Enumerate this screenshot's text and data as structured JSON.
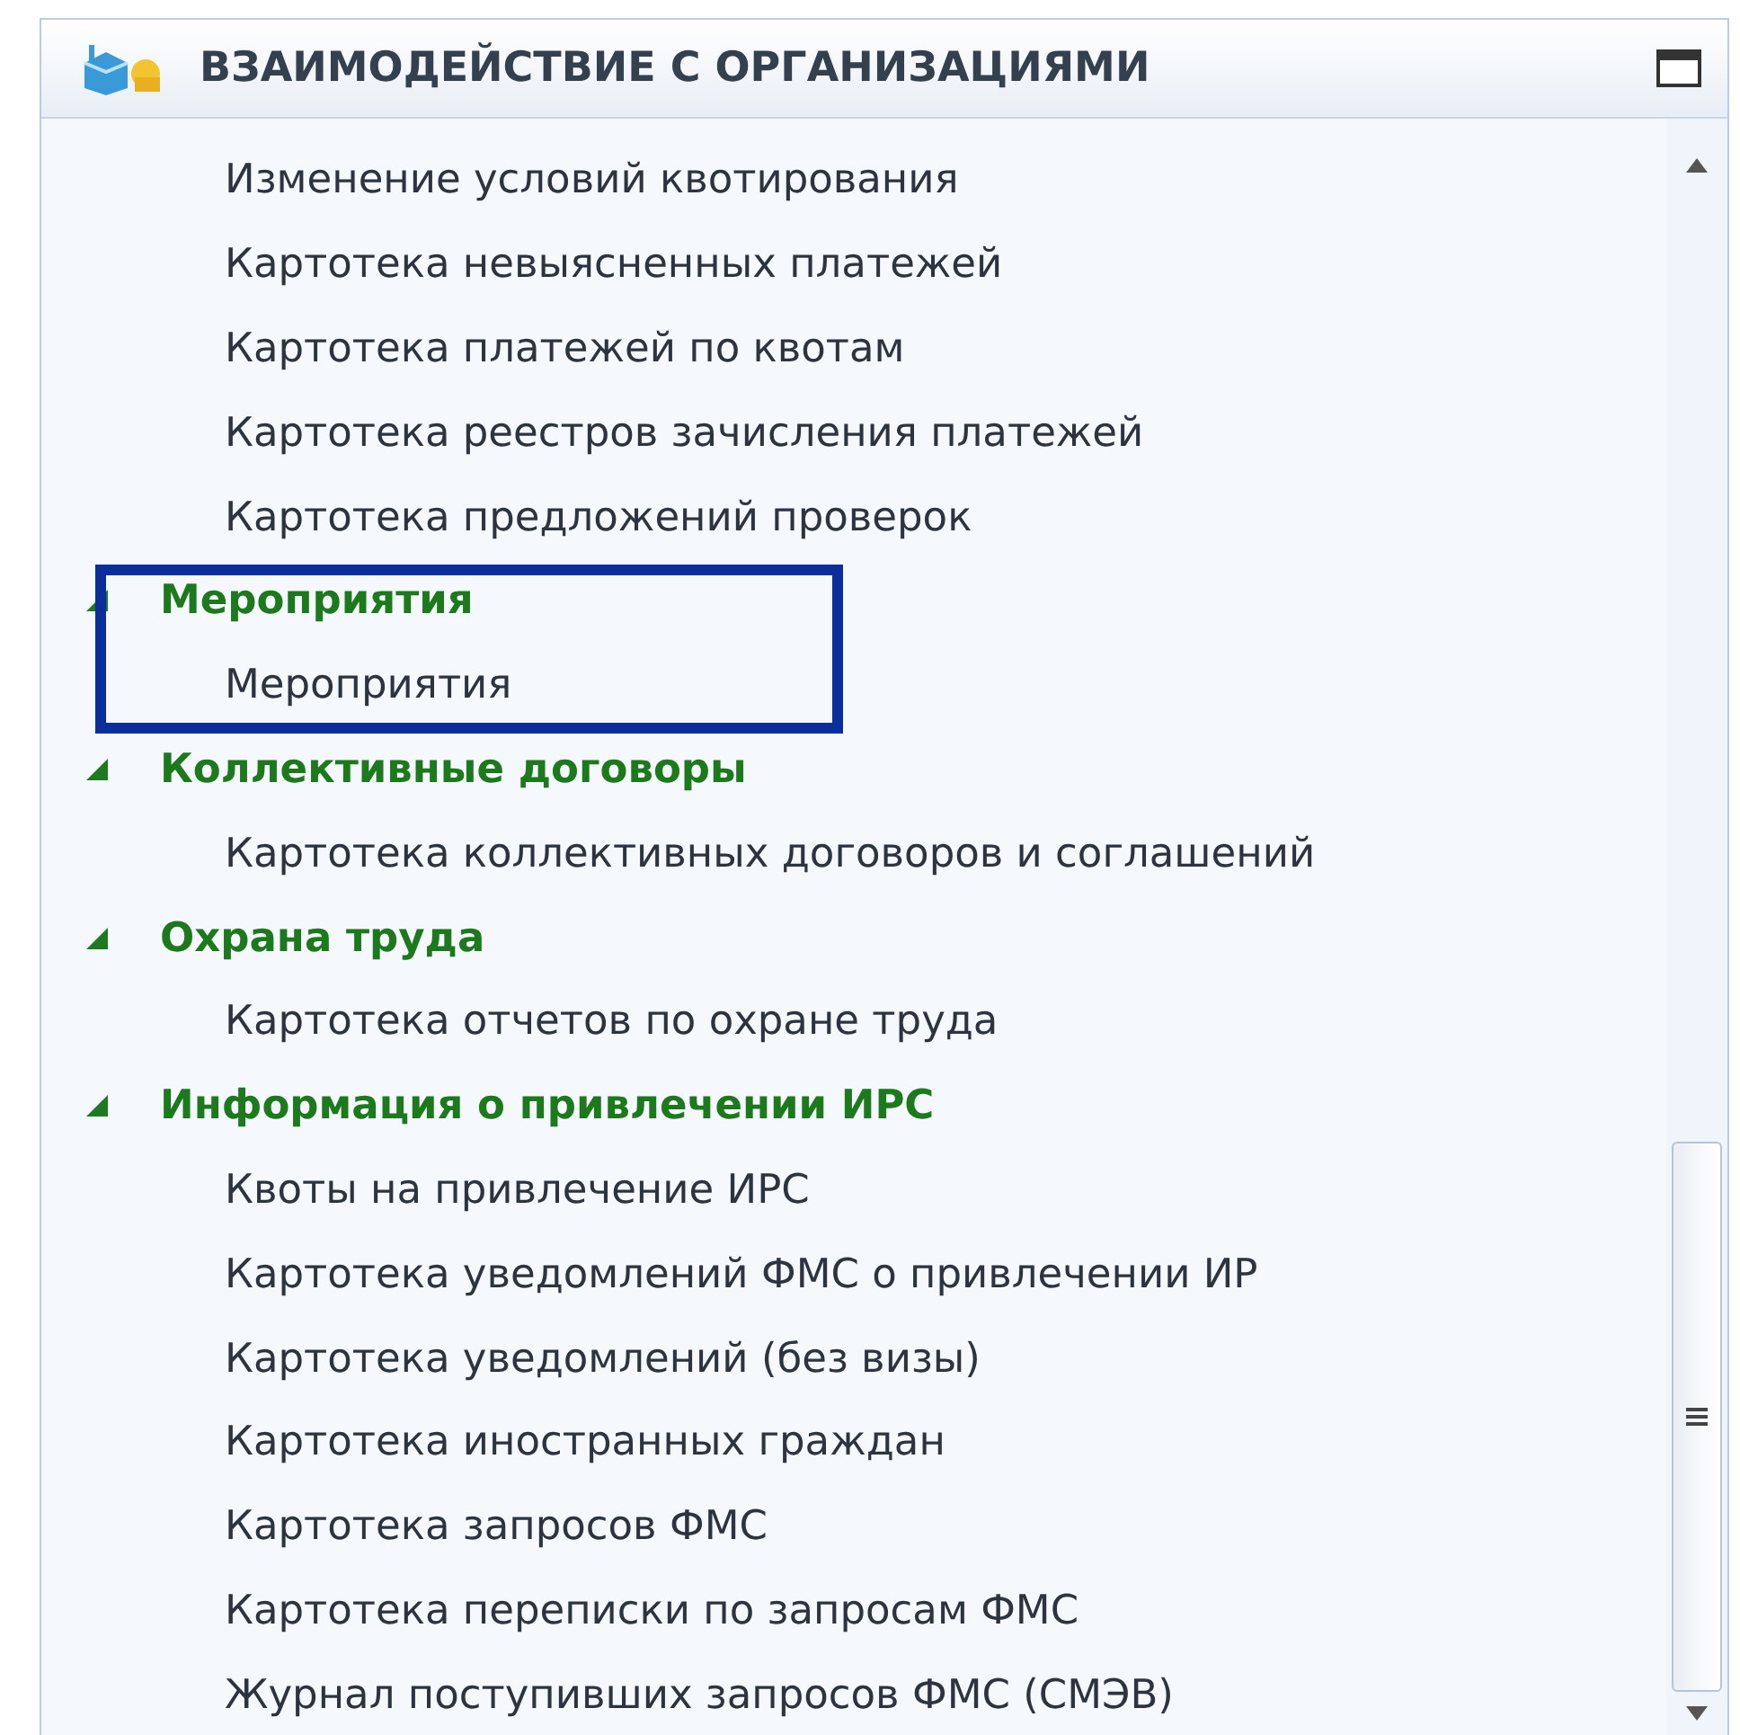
{
  "panel": {
    "title": "ВЗАИМОДЕЙСТВИЕ С ОРГАНИЗАЦИЯМИ"
  },
  "items": [
    "Изменение условий квотирования",
    "Картотека невыясненных платежей",
    "Картотека платежей по квотам",
    "Картотека реестров зачисления платежей",
    "Картотека предложений проверок"
  ],
  "groups": [
    {
      "title": "Мероприятия",
      "expanded": true,
      "highlighted": true,
      "items": [
        "Мероприятия"
      ]
    },
    {
      "title": "Коллективные договоры",
      "expanded": true,
      "highlighted": false,
      "items": [
        "Картотека коллективных договоров и соглашений"
      ]
    },
    {
      "title": "Охрана труда",
      "expanded": true,
      "highlighted": false,
      "items": [
        "Картотека отчетов по охране труда"
      ]
    },
    {
      "title": "Информация о привлечении ИРС",
      "expanded": true,
      "highlighted": false,
      "items": [
        "Квоты на привлечение ИРС",
        "Картотека уведомлений ФМС о привлечении ИР",
        "Картотека уведомлений (без визы)",
        "Картотека иностранных граждан",
        "Картотека запросов ФМС",
        "Картотека переписки по запросам ФМС",
        "Журнал поступивших запросов ФМС (СМЭВ)"
      ]
    }
  ]
}
